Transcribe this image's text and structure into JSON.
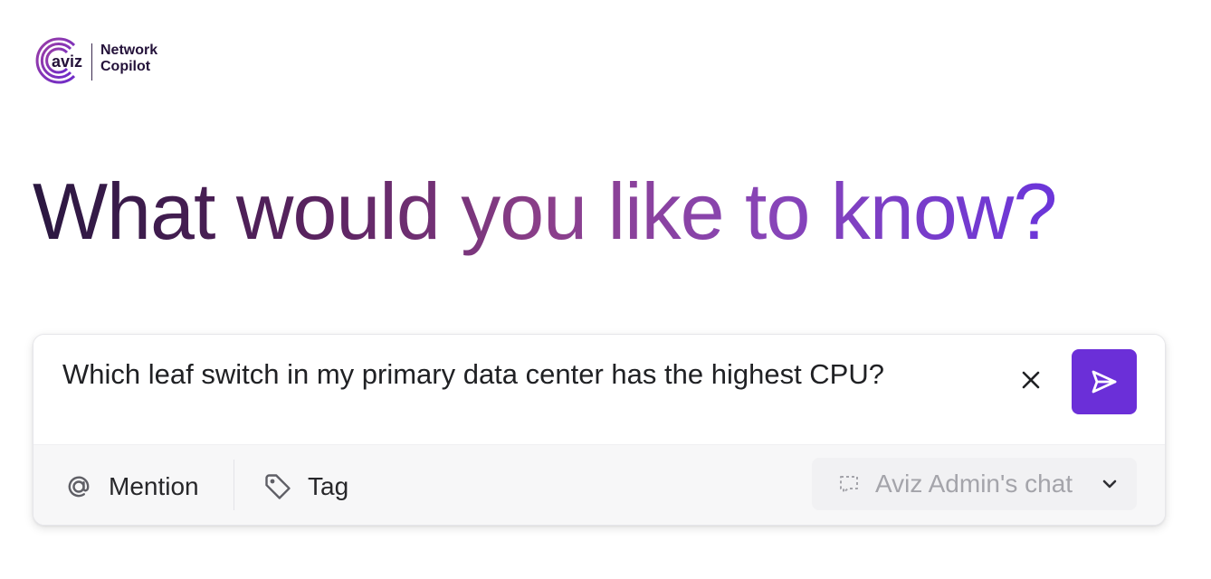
{
  "brand": {
    "logo_text": "aviz",
    "product_line1": "Network",
    "product_line2": "Copilot"
  },
  "hero": {
    "title": "What would you like to know?"
  },
  "composer": {
    "query": "Which leaf switch in my primary data center has the highest CPU?",
    "icons": {
      "clear": "close-icon",
      "send": "send-icon"
    },
    "actions": {
      "mention": {
        "label": "Mention",
        "icon": "at-sign-icon"
      },
      "tag": {
        "label": "Tag",
        "icon": "tag-icon"
      }
    },
    "chat_selector": {
      "label": "Aviz Admin's chat",
      "icon": "chat-bubble-icon",
      "dropdown_icon": "chevron-down-icon"
    }
  },
  "colors": {
    "accent": "#6b2fd8",
    "heading_start": "#2a1740",
    "heading_mid": "#8b3f8a",
    "heading_end": "#6b35da"
  }
}
